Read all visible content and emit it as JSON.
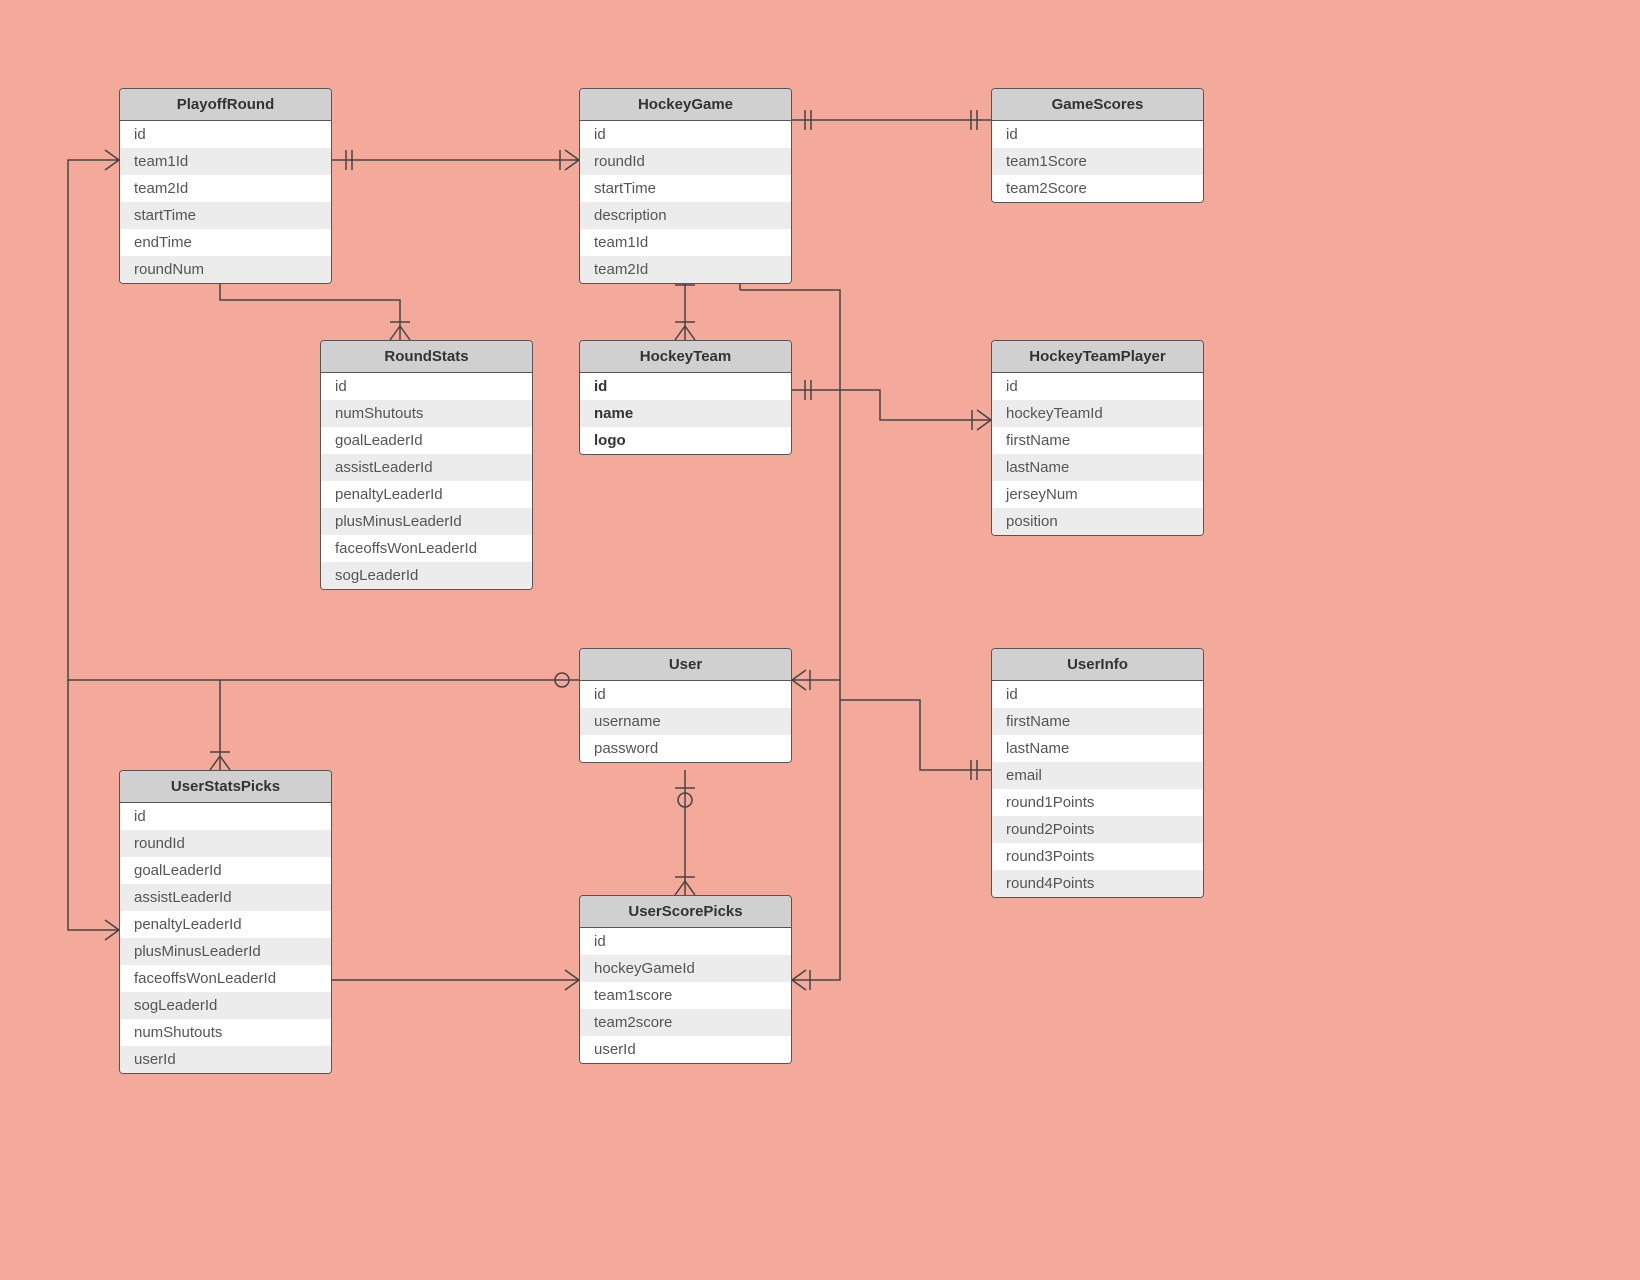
{
  "entities": {
    "playoffRound": {
      "title": "PlayoffRound",
      "fields": [
        "id",
        "team1Id",
        "team2Id",
        "startTime",
        "endTime",
        "roundNum"
      ]
    },
    "hockeyGame": {
      "title": "HockeyGame",
      "fields": [
        "id",
        "roundId",
        "startTime",
        "description",
        "team1Id",
        "team2Id"
      ]
    },
    "gameScores": {
      "title": "GameScores",
      "fields": [
        "id",
        "team1Score",
        "team2Score"
      ]
    },
    "roundStats": {
      "title": "RoundStats",
      "fields": [
        "id",
        "numShutouts",
        "goalLeaderId",
        "assistLeaderId",
        "penaltyLeaderId",
        "plusMinusLeaderId",
        "faceoffsWonLeaderId",
        "sogLeaderId"
      ]
    },
    "hockeyTeam": {
      "title": "HockeyTeam",
      "fields": [
        "id",
        "name",
        "logo"
      ]
    },
    "hockeyTeamPlayer": {
      "title": "HockeyTeamPlayer",
      "fields": [
        "id",
        "hockeyTeamId",
        "firstName",
        "lastName",
        "jerseyNum",
        "position"
      ]
    },
    "user": {
      "title": "User",
      "fields": [
        "id",
        "username",
        "password"
      ]
    },
    "userInfo": {
      "title": "UserInfo",
      "fields": [
        "id",
        "firstName",
        "lastName",
        "email",
        "round1Points",
        "round2Points",
        "round3Points",
        "round4Points"
      ]
    },
    "userStatsPicks": {
      "title": "UserStatsPicks",
      "fields": [
        "id",
        "roundId",
        "goalLeaderId",
        "assistLeaderId",
        "penaltyLeaderId",
        "plusMinusLeaderId",
        "faceoffsWonLeaderId",
        "sogLeaderId",
        "numShutouts",
        "userId"
      ]
    },
    "userScorePicks": {
      "title": "UserScorePicks",
      "fields": [
        "id",
        "hockeyGameId",
        "team1score",
        "team2score",
        "userId"
      ]
    }
  }
}
